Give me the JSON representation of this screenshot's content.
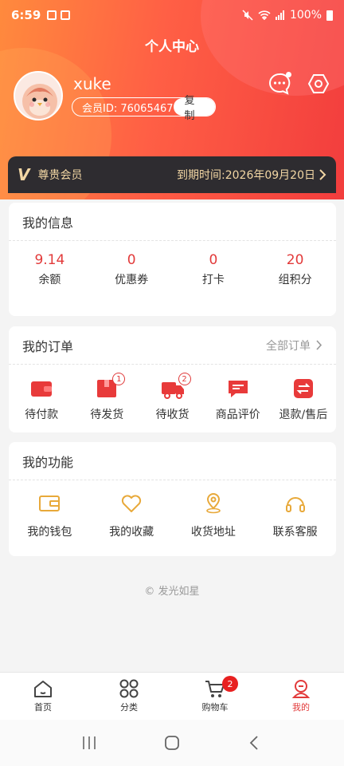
{
  "status_bar": {
    "time": "6:59",
    "battery": "100%"
  },
  "header": {
    "title": "个人中心"
  },
  "profile": {
    "username": "xuke",
    "member_id_label": "会员ID: 76065467",
    "copy_label": "复制"
  },
  "vip": {
    "logo": "V",
    "label": "尊贵会员",
    "expire_label": "到期时间:2026年09月20日"
  },
  "info": {
    "title": "我的信息",
    "items": [
      {
        "value": "9.14",
        "label": "余额"
      },
      {
        "value": "0",
        "label": "优惠券"
      },
      {
        "value": "0",
        "label": "打卡"
      },
      {
        "value": "20",
        "label": "组积分"
      }
    ]
  },
  "orders": {
    "title": "我的订单",
    "all_label": "全部订单",
    "items": [
      {
        "label": "待付款",
        "icon": "wallet-icon"
      },
      {
        "label": "待发货",
        "icon": "box-icon",
        "badge": "1"
      },
      {
        "label": "待收货",
        "icon": "truck-icon",
        "badge": "2"
      },
      {
        "label": "商品评价",
        "icon": "comment-icon"
      },
      {
        "label": "退款/售后",
        "icon": "refund-icon"
      }
    ]
  },
  "functions": {
    "title": "我的功能",
    "items": [
      {
        "label": "我的钱包",
        "icon": "wallet-icon"
      },
      {
        "label": "我的收藏",
        "icon": "heart-icon"
      },
      {
        "label": "收货地址",
        "icon": "location-icon"
      },
      {
        "label": "联系客服",
        "icon": "headset-icon"
      }
    ]
  },
  "footer": {
    "copyright": "© 发光如星"
  },
  "tabbar": {
    "items": [
      {
        "label": "首页",
        "icon": "home-icon"
      },
      {
        "label": "分类",
        "icon": "grid-icon"
      },
      {
        "label": "购物车",
        "icon": "cart-icon",
        "badge": "2"
      },
      {
        "label": "我的",
        "icon": "user-icon",
        "active": true
      }
    ]
  },
  "colors": {
    "accent": "#e23a3a",
    "gold": "#e8a93a",
    "vip_gold": "#f3d7a4"
  }
}
